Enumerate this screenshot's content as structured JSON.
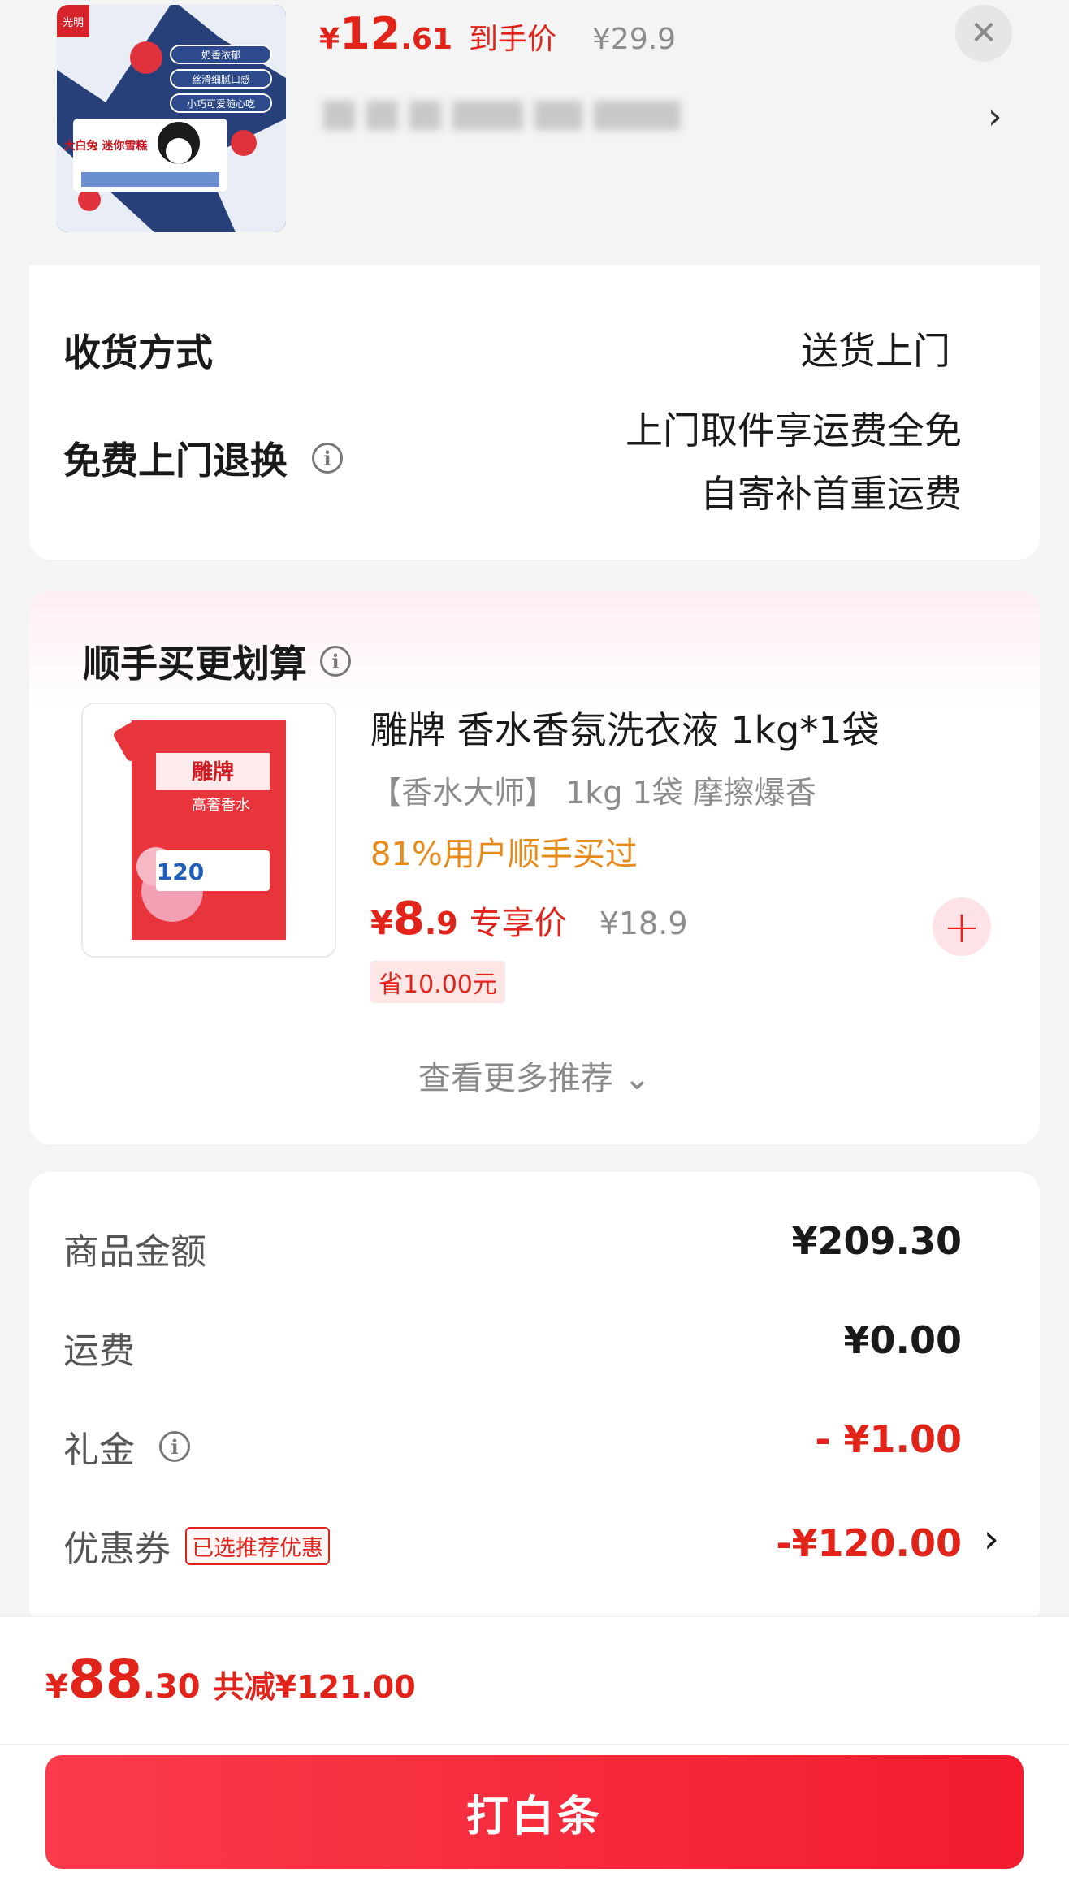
{
  "top_product": {
    "price_yen": "¥",
    "price_int": "12",
    "price_dec": ".61",
    "price_tag": "到手价",
    "original_price": "¥29.9",
    "close_glyph": "✕",
    "chevron": "›",
    "image_badges": [
      "奶香浓郁",
      "丝滑细腻口感",
      "小巧可爱随心吃"
    ],
    "image_brand": "光明",
    "image_pack": "大白兔 迷你雪糕"
  },
  "delivery": {
    "method_label": "收货方式",
    "method_value": "送货上门",
    "return_label": "免费上门退换",
    "return_value_1": "上门取件享运费全免",
    "return_value_2": "自寄补首重运费",
    "info_glyph": "i"
  },
  "recommend": {
    "title": "顺手买更划算",
    "product_name": "雕牌 香水香氛洗衣液 1kg*1袋",
    "product_spec": "【香水大师】 1kg 1袋 摩擦爆香",
    "bought_text": "81%用户顺手买过",
    "price_yen": "¥",
    "price_int": "8",
    "price_dec": ".9",
    "price_tag": "专享价",
    "original_price": "¥18.9",
    "save_badge": "省10.00元",
    "add_glyph": "+",
    "see_more": "查看更多推荐 ⌄",
    "image_brand": "雕牌",
    "image_line": "高奢香水",
    "image_number": "120"
  },
  "summary": {
    "goods_label": "商品金额",
    "goods_value": "¥209.30",
    "shipping_label": "运费",
    "shipping_value": "¥0.00",
    "gift_label": "礼金",
    "gift_value": "- ¥1.00",
    "coupon_label": "优惠券",
    "coupon_badge": "已选推荐优惠",
    "coupon_value": "-¥120.00",
    "coupon_chevron": "›"
  },
  "checkout": {
    "total_yen": "¥",
    "total_int": "88",
    "total_dec": ".30",
    "total_cut": "共减¥121.00",
    "pay_button": "打白条"
  },
  "colors": {
    "accent_red": "#e2231a",
    "bought_orange": "#e88a1a",
    "background": "#f4f4f4"
  }
}
